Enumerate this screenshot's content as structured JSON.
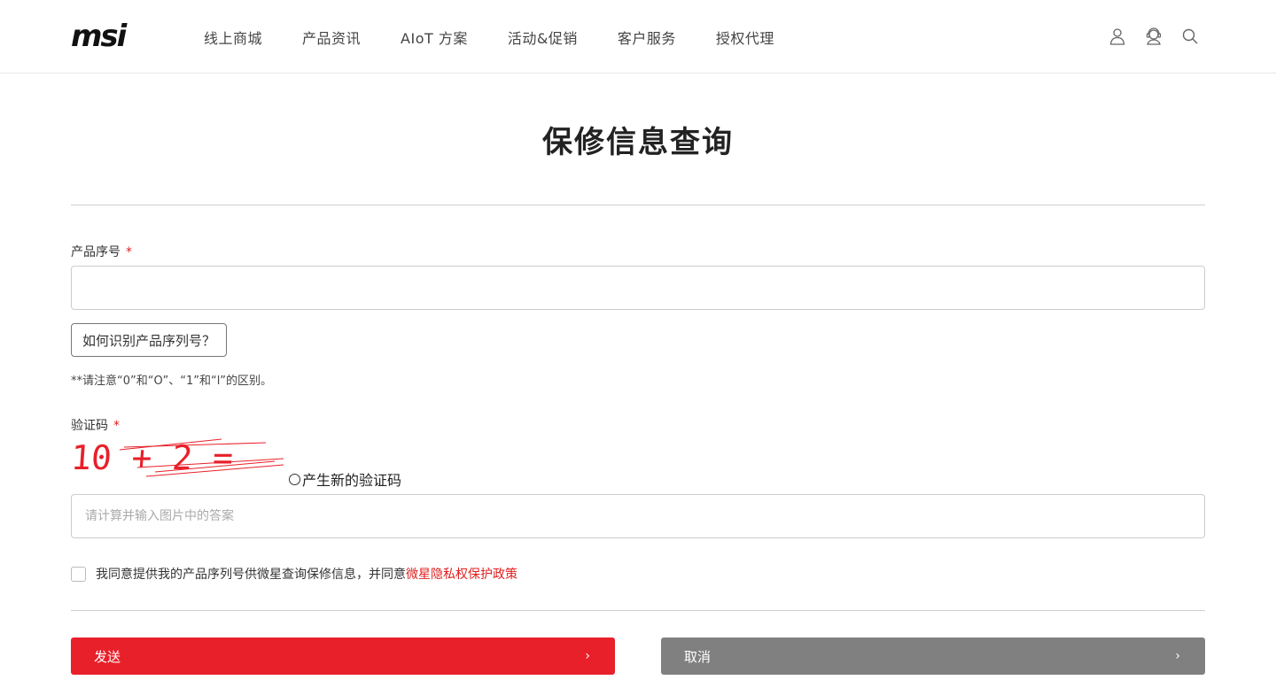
{
  "header": {
    "logo_text": "msi",
    "nav": [
      "线上商城",
      "产品资讯",
      "AIoT 方案",
      "活动&促销",
      "客户服务",
      "授权代理"
    ],
    "icons": [
      "user-icon",
      "support-agent-icon",
      "search-icon"
    ]
  },
  "page": {
    "title": "保修信息查询"
  },
  "form": {
    "serial_label": "产品序号",
    "required_mark": "*",
    "serial_value": "",
    "serial_help_button": "如何识别产品序列号？",
    "serial_note": "**请注意“0”和“O”、“1”和“l”的区别。",
    "captcha_label": "验证码",
    "captcha_image_text": "10 + 2 =",
    "captcha_refresh": "产生新的验证码",
    "captcha_placeholder": "请计算并输入图片中的答案",
    "agree_text": "我同意提供我的产品序列号供微星查询保修信息，并同意",
    "agree_link": "微星隐私权保护政策",
    "agree_checked": false
  },
  "buttons": {
    "send": "发送",
    "cancel": "取消",
    "chevron": "›"
  },
  "colors": {
    "brand_red": "#e8202a",
    "cancel_gray": "#808080",
    "link_red": "#e02020"
  }
}
